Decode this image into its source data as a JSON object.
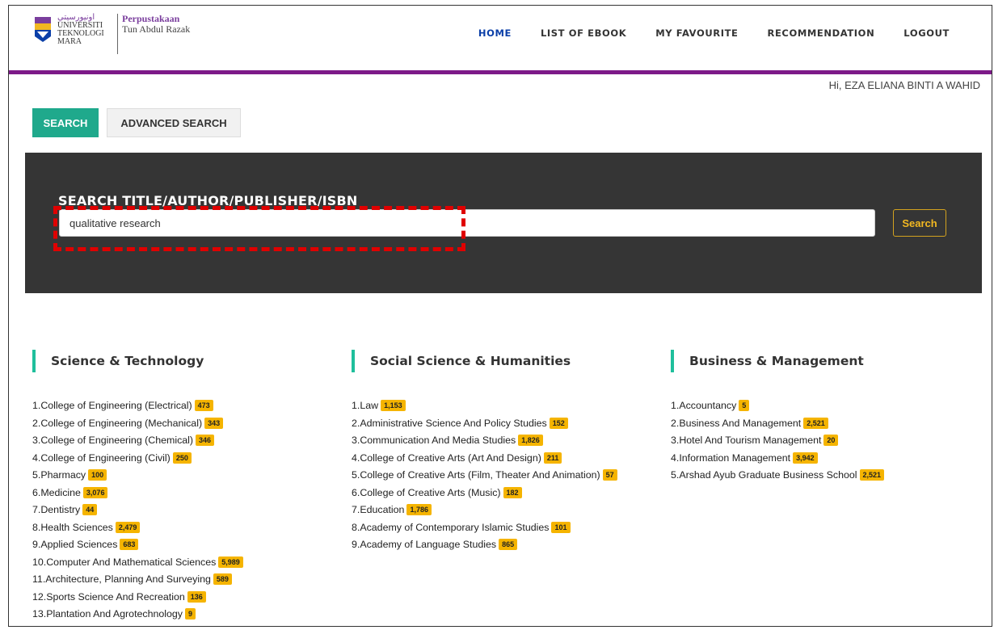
{
  "logo": {
    "uni_line1": "UNIVERSITI",
    "uni_line2": "TEKNOLOGI",
    "uni_line3": "MARA",
    "lib_line1": "Perpustakaan",
    "lib_line2": "Tun Abdul Razak"
  },
  "nav": [
    {
      "label": "HOME"
    },
    {
      "label": "LIST OF EBOOK"
    },
    {
      "label": "MY FAVOURITE"
    },
    {
      "label": "RECOMMENDATION"
    },
    {
      "label": "LOGOUT"
    }
  ],
  "greeting": "Hi, EZA ELIANA BINTI A WAHID",
  "tabs": {
    "search": "SEARCH",
    "advanced": "ADVANCED SEARCH"
  },
  "search": {
    "label": "SEARCH TITLE/AUTHOR/PUBLISHER/ISBN",
    "value": "qualitative research",
    "button": "Search"
  },
  "colors": {
    "accent": "#1fa98c",
    "header_bar": "#7d1a88",
    "badge": "#f5b400",
    "highlight": "#e00000"
  },
  "categories": [
    {
      "title": "Science & Technology",
      "items": [
        {
          "label": "1.College of Engineering (Electrical)",
          "count": "473"
        },
        {
          "label": "2.College of Engineering (Mechanical)",
          "count": "343"
        },
        {
          "label": "3.College of Engineering (Chemical)",
          "count": "346"
        },
        {
          "label": "4.College of Engineering (Civil)",
          "count": "250"
        },
        {
          "label": "5.Pharmacy",
          "count": "100"
        },
        {
          "label": "6.Medicine",
          "count": "3,076"
        },
        {
          "label": "7.Dentistry",
          "count": "44"
        },
        {
          "label": "8.Health Sciences",
          "count": "2,479"
        },
        {
          "label": "9.Applied Sciences",
          "count": "683"
        },
        {
          "label": "10.Computer And Mathematical Sciences",
          "count": "5,989"
        },
        {
          "label": "11.Architecture, Planning And Surveying",
          "count": "589"
        },
        {
          "label": "12.Sports Science And Recreation",
          "count": "136"
        },
        {
          "label": "13.Plantation And Agrotechnology",
          "count": "9"
        }
      ]
    },
    {
      "title": "Social Science & Humanities",
      "items": [
        {
          "label": "1.Law",
          "count": "1,153"
        },
        {
          "label": "2.Administrative Science And Policy Studies",
          "count": "152"
        },
        {
          "label": "3.Communication And Media Studies",
          "count": "1,826"
        },
        {
          "label": "4.College of Creative Arts (Art And Design)",
          "count": "211"
        },
        {
          "label": "5.College of Creative Arts (Film, Theater And Animation)",
          "count": "57"
        },
        {
          "label": "6.College of Creative Arts (Music)",
          "count": "182"
        },
        {
          "label": "7.Education",
          "count": "1,786"
        },
        {
          "label": "8.Academy of Contemporary Islamic Studies",
          "count": "101"
        },
        {
          "label": "9.Academy of Language Studies",
          "count": "865"
        }
      ]
    },
    {
      "title": "Business & Management",
      "items": [
        {
          "label": "1.Accountancy",
          "count": "5"
        },
        {
          "label": "2.Business And Management",
          "count": "2,521"
        },
        {
          "label": "3.Hotel And Tourism Management",
          "count": "20"
        },
        {
          "label": "4.Information Management",
          "count": "3,942"
        },
        {
          "label": "5.Arshad Ayub Graduate Business School",
          "count": "2,521"
        }
      ]
    }
  ]
}
